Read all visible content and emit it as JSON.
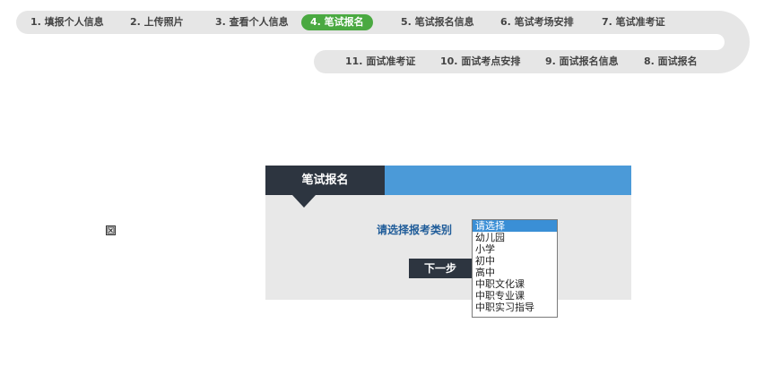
{
  "steps_top": [
    {
      "label": "1. 填报个人信息"
    },
    {
      "label": "2. 上传照片"
    },
    {
      "label": "3. 查看个人信息"
    },
    {
      "label": "4. 笔试报名",
      "active": true
    },
    {
      "label": "5. 笔试报名信息"
    },
    {
      "label": "6. 笔试考场安排"
    },
    {
      "label": "7. 笔试准考证"
    }
  ],
  "steps_bottom": [
    {
      "label": "11. 面试准考证"
    },
    {
      "label": "10. 面试考点安排"
    },
    {
      "label": "9. 面试报名信息"
    },
    {
      "label": "8. 面试报名"
    }
  ],
  "panel": {
    "tab_title": "笔试报名",
    "category_label": "请选择报考类别",
    "next_button": "下一步"
  },
  "listbox": {
    "options": [
      "请选择",
      "幼儿园",
      "小学",
      "初中",
      "高中",
      "中职文化课",
      "中职专业课",
      "中职实习指导"
    ],
    "selected_index": 0
  },
  "colors": {
    "track": "#e6e6e6",
    "active_step": "#4aa941",
    "panel_header_blue": "#4b9ad8",
    "panel_tab_dark": "#2d3540",
    "label_blue": "#1f5c99",
    "panel_bg": "#e8e8e8"
  }
}
